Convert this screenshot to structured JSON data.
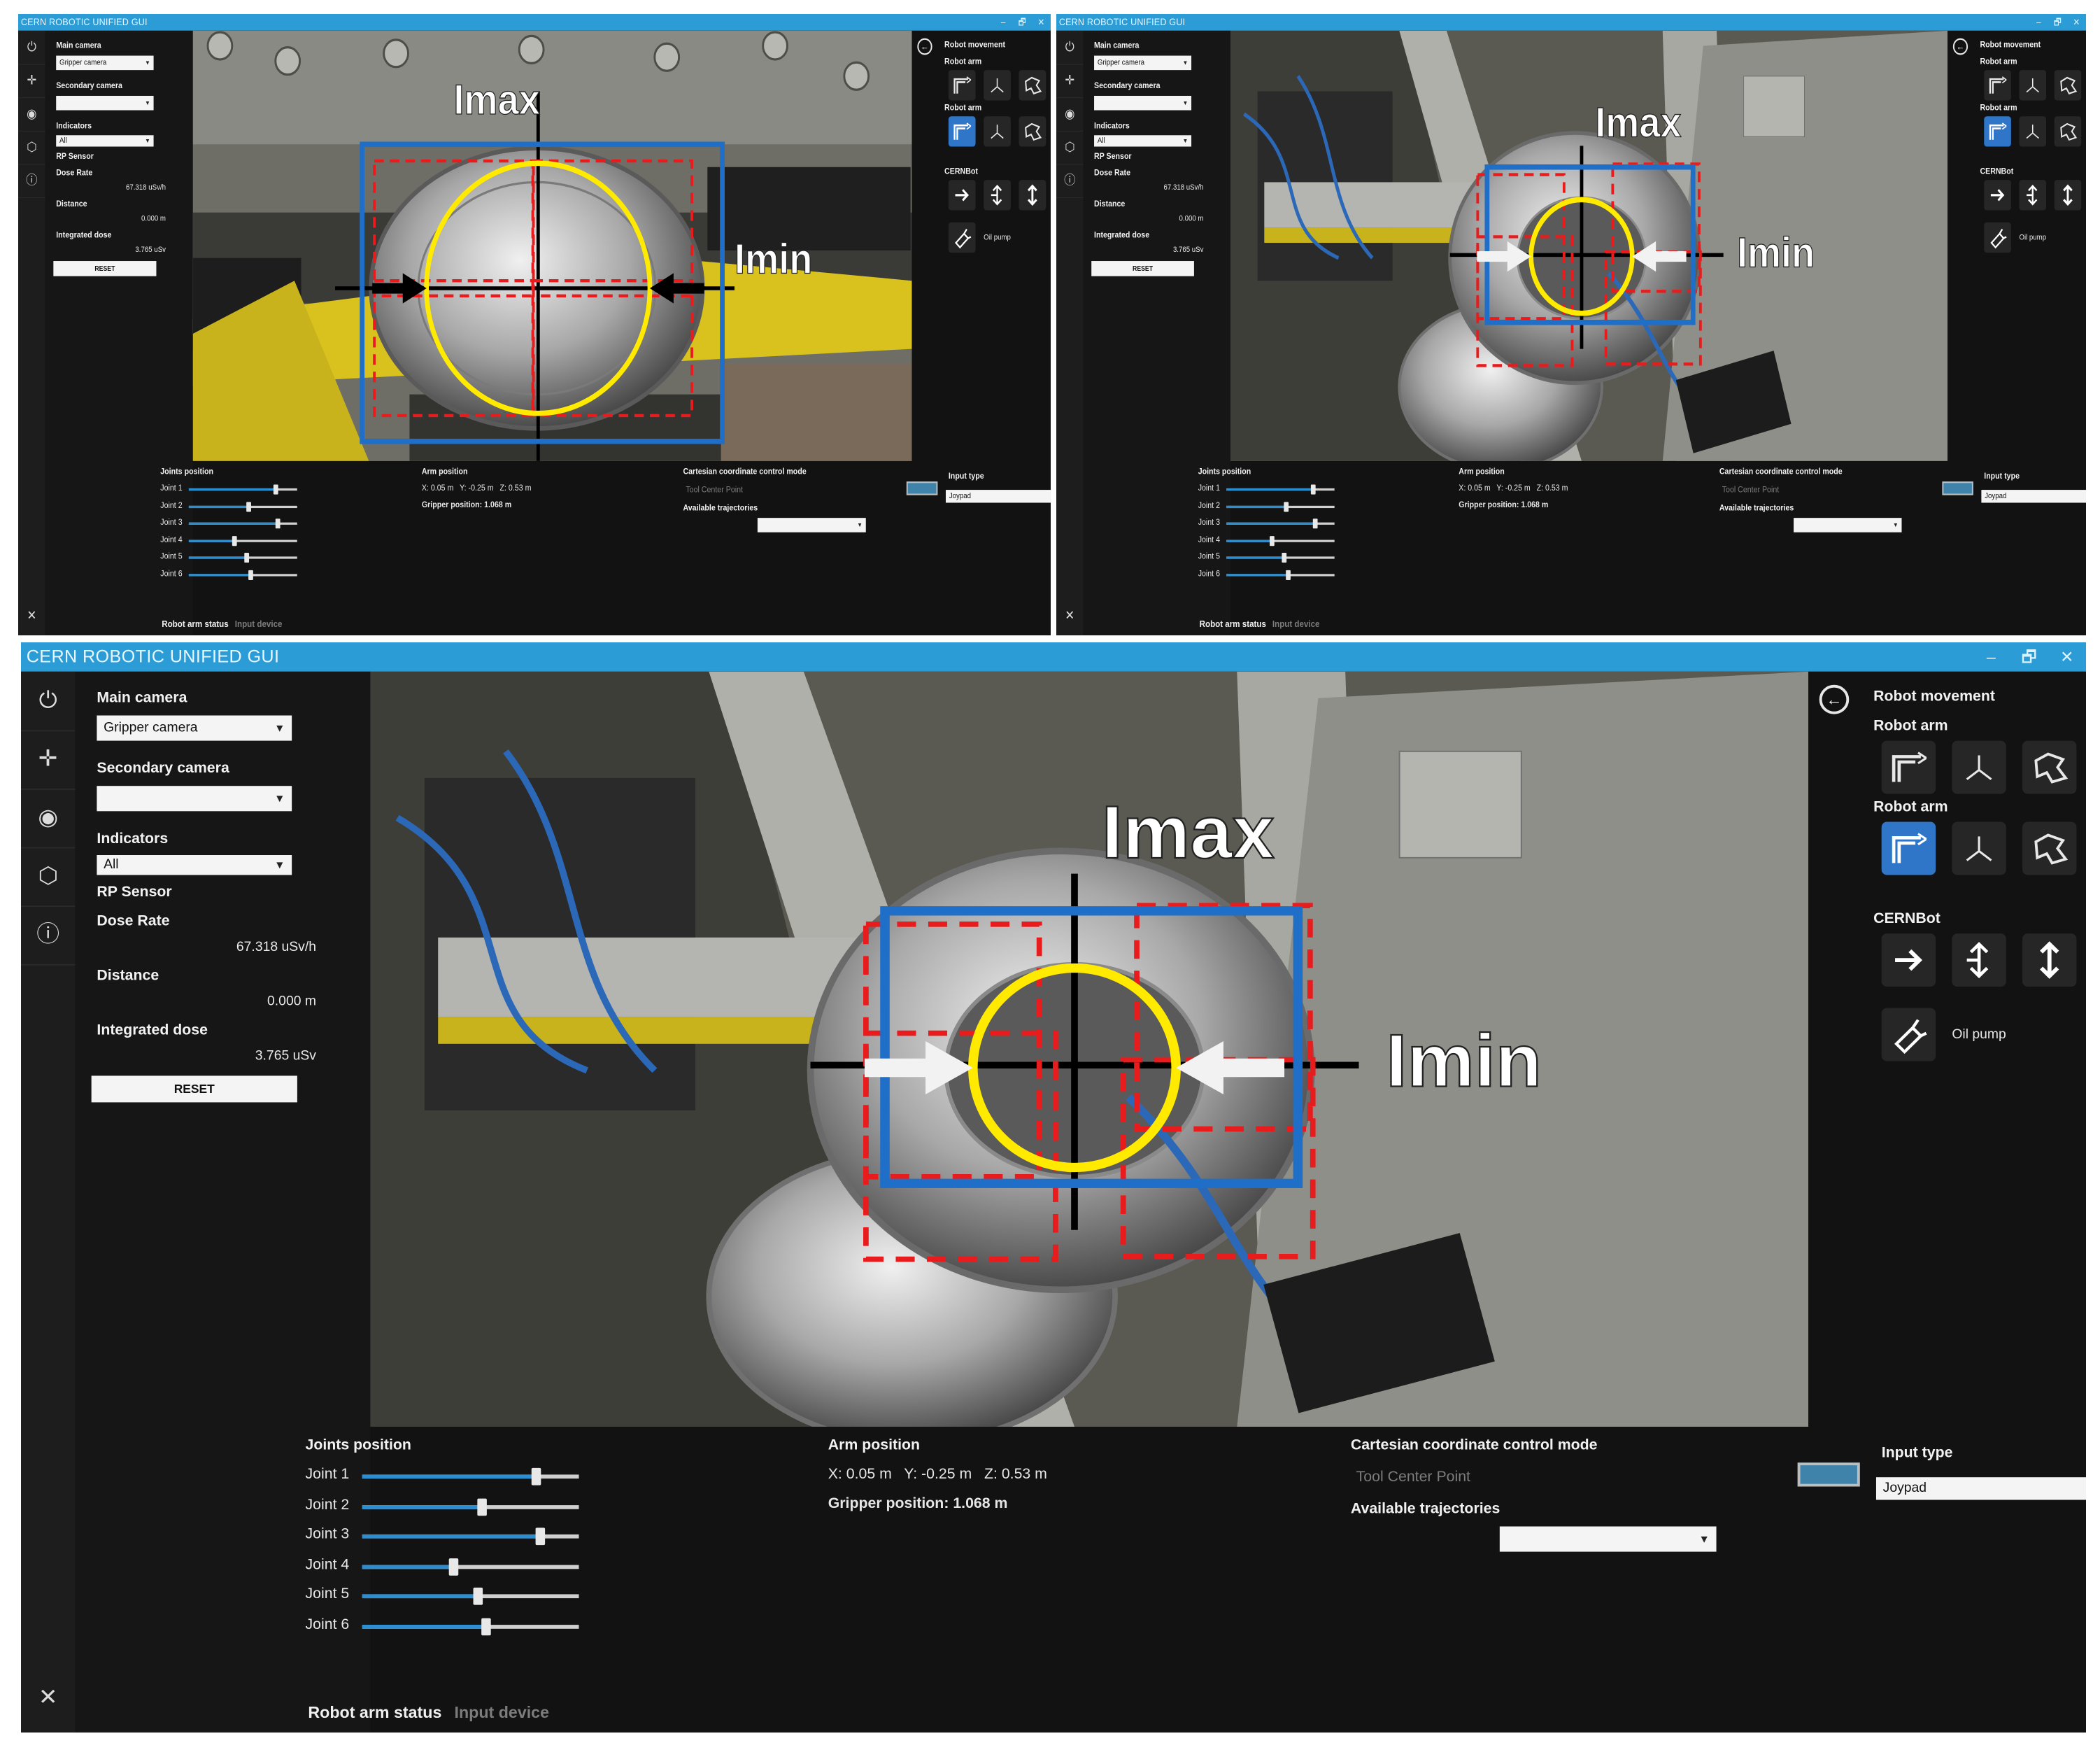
{
  "window": {
    "title": "CERN ROBOTIC UNIFIED GUI",
    "controls": [
      "–",
      "🗗",
      "✕"
    ]
  },
  "rail": {
    "icons": [
      "power-icon",
      "move-icon",
      "eye-icon",
      "settings-hex-icon",
      "info-icon",
      "tools-icon"
    ]
  },
  "left_panel": {
    "main_camera_label": "Main camera",
    "main_camera_value": "Gripper camera",
    "secondary_camera_label": "Secondary camera",
    "secondary_camera_value": "",
    "indicators_label": "Indicators",
    "indicators_value": "All",
    "rp_sensor_label": "RP Sensor",
    "dose_rate_label": "Dose Rate",
    "dose_rate_value": "67.318 uSv/h",
    "distance_label": "Distance",
    "distance_value": "0.000 m",
    "integrated_dose_label": "Integrated dose",
    "integrated_dose_value": "3.765 uSv",
    "reset_label": "RESET"
  },
  "video": {
    "imax_label": "Imax",
    "imin_label": "Imin"
  },
  "robot_movement": {
    "title": "Robot movement",
    "robot_arm_label_1": "Robot arm",
    "robot_arm_label_2": "Robot arm",
    "cernbot_label": "CERNBot",
    "oil_pump_label": "Oil pump",
    "axis_z": "z",
    "axis_xy": "x y"
  },
  "bottom": {
    "joints_title": "Joints position",
    "joints": [
      {
        "label": "Joint 1",
        "value": 0.8
      },
      {
        "label": "Joint 2",
        "value": 0.55
      },
      {
        "label": "Joint 3",
        "value": 0.82
      },
      {
        "label": "Joint 4",
        "value": 0.42
      },
      {
        "label": "Joint 5",
        "value": 0.53
      },
      {
        "label": "Joint 6",
        "value": 0.57
      }
    ],
    "arm_position_title": "Arm position",
    "arm_position_xyz": "X: 0.05 m   Y: -0.25 m   Z: 0.53 m",
    "gripper_position": "Gripper position: 1.068 m",
    "cartesian_title": "Cartesian coordinate control mode",
    "tool_center_point": "Tool Center Point",
    "available_trajectories": "Available trajectories",
    "input_type_label": "Input type",
    "input_type_value": "Joypad",
    "status_label": "Robot arm status",
    "input_device_label": "Input device"
  },
  "colors": {
    "titlebar": "#2c9cd6",
    "accent_blue": "#2f76c9",
    "bbox_blue": "#1f6fc8",
    "roi_red": "#e81c1c",
    "target_yellow": "#ffea00"
  }
}
